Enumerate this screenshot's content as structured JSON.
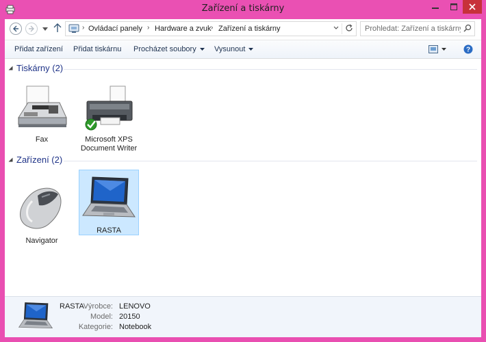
{
  "window": {
    "title": "Zařízení a tiskárny",
    "accent": "#ea50b3",
    "close_color": "#c7313a"
  },
  "navigation": {
    "breadcrumbs": [
      "Ovládací panely",
      "Hardware a zvuk",
      "Zařízení a tiskárny"
    ],
    "search_placeholder": "Prohledat: Zařízení a tiskárny"
  },
  "toolbar": {
    "add_device": "Přidat zařízení",
    "add_printer": "Přidat tiskárnu",
    "browse_files": "Procházet soubory",
    "eject": "Vysunout"
  },
  "groups": [
    {
      "header": "Tiskárny (2)",
      "items": [
        {
          "label": "Fax",
          "icon": "fax-icon"
        },
        {
          "label": "Microsoft XPS Document Writer",
          "icon": "printer-icon",
          "default": true
        }
      ]
    },
    {
      "header": "Zařízení (2)",
      "items": [
        {
          "label": "Navigator",
          "icon": "mouse-icon"
        },
        {
          "label": "RASTA",
          "icon": "laptop-icon",
          "selected": true
        }
      ]
    }
  ],
  "details": {
    "name": "RASTA",
    "fields": [
      {
        "label": "Výrobce:",
        "value": "LENOVO"
      },
      {
        "label": "Model:",
        "value": "20150"
      },
      {
        "label": "Kategorie:",
        "value": "Notebook"
      }
    ]
  }
}
